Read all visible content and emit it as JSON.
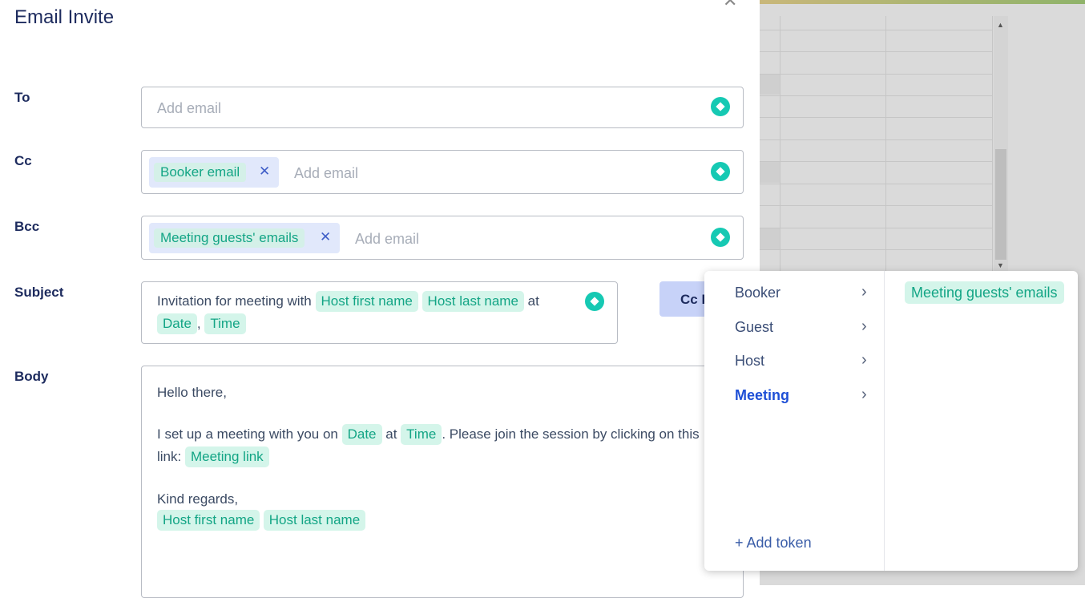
{
  "modal": {
    "title": "Email Invite",
    "close_icon": "close-icon"
  },
  "fields": {
    "to": {
      "label": "To",
      "placeholder": "Add email"
    },
    "cc": {
      "label": "Cc",
      "chip": "Booker email",
      "placeholder": "Add email"
    },
    "bcc": {
      "label": "Bcc",
      "chip": "Meeting guests' emails",
      "placeholder": "Add email"
    },
    "subject": {
      "label": "Subject",
      "prefix": "Invitation for meeting with",
      "tag1": "Host first name",
      "tag2": "Host last name",
      "mid": "at",
      "tag3": "Date",
      "sep": ",",
      "tag4": "Time"
    },
    "body": {
      "label": "Body",
      "greeting": "Hello there,",
      "line_prefix": "I set up a meeting with you on",
      "tag_date": "Date",
      "at": "at",
      "tag_time": "Time",
      "line_suffix": ". Please join the session by clicking on this",
      "link_prefix": "link:",
      "tag_link": "Meeting link",
      "closing": "Kind regards,",
      "sig1": "Host first name",
      "sig2": "Host last name"
    }
  },
  "cc_button": {
    "label": "Cc B"
  },
  "token_menu": {
    "categories": [
      "Booker",
      "Guest",
      "Host",
      "Meeting"
    ],
    "active": "Meeting",
    "add_token": "+ Add token",
    "options": [
      "Meeting guests' emails"
    ]
  },
  "colors": {
    "accent": "#16c9b3",
    "tag_bg": "#d4f5ea",
    "tag_text": "#13a585",
    "heading": "#1d2b5e",
    "active_menu": "#1e4fd6"
  }
}
